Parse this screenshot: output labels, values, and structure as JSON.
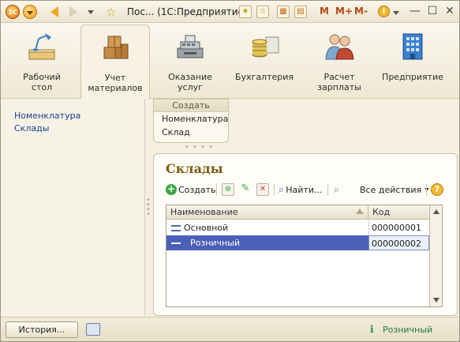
{
  "window": {
    "title": "Пос...  (1С:Предприятие)",
    "logo_text": "1С"
  },
  "titlebar_tools": {
    "mem_labels": [
      "M",
      "M+",
      "M-"
    ],
    "info_label": "i",
    "minimize": "—",
    "maximize": "☐",
    "close": "✕"
  },
  "sections": [
    {
      "id": "desktop",
      "line1": "Рабочий",
      "line2": "стол",
      "icon": "desk-lamp-icon",
      "active": false
    },
    {
      "id": "inventory",
      "line1": "Учет",
      "line2": "материалов",
      "icon": "boxes-icon",
      "active": true
    },
    {
      "id": "services",
      "line1": "Оказание",
      "line2": "услуг",
      "icon": "cash-register-icon",
      "active": false
    },
    {
      "id": "accounting",
      "line1": "Бухгалтерия",
      "line2": "",
      "icon": "coins-icon",
      "active": false
    },
    {
      "id": "payroll",
      "line1": "Расчет",
      "line2": "зарплаты",
      "icon": "people-icon",
      "active": false
    },
    {
      "id": "enterprise",
      "line1": "Предприятие",
      "line2": "",
      "icon": "building-icon",
      "active": false
    }
  ],
  "navigation": {
    "items": [
      "Номенклатура",
      "Склады"
    ]
  },
  "actions_panel": {
    "header": "Создать",
    "items": [
      "Номенклатура",
      "Склад"
    ]
  },
  "form": {
    "title": "Склады",
    "toolbar": {
      "create": "Создать",
      "find": "Найти...",
      "all_actions": "Все действия",
      "help": "?"
    },
    "columns": [
      "Наименование",
      "Код"
    ],
    "rows": [
      {
        "name": "Основной",
        "code": "000000001",
        "selected": false
      },
      {
        "name": "Розничный",
        "code": "000000002",
        "selected": true
      }
    ]
  },
  "statusbar": {
    "history_button": "История...",
    "info_icon": "i",
    "status_text": "Розничный"
  },
  "colors": {
    "accent": "#f1a422",
    "link": "#1f3f8a",
    "form_title": "#7a5b11",
    "selection": "#4a5fb7",
    "status_text": "#1d7a3a"
  }
}
